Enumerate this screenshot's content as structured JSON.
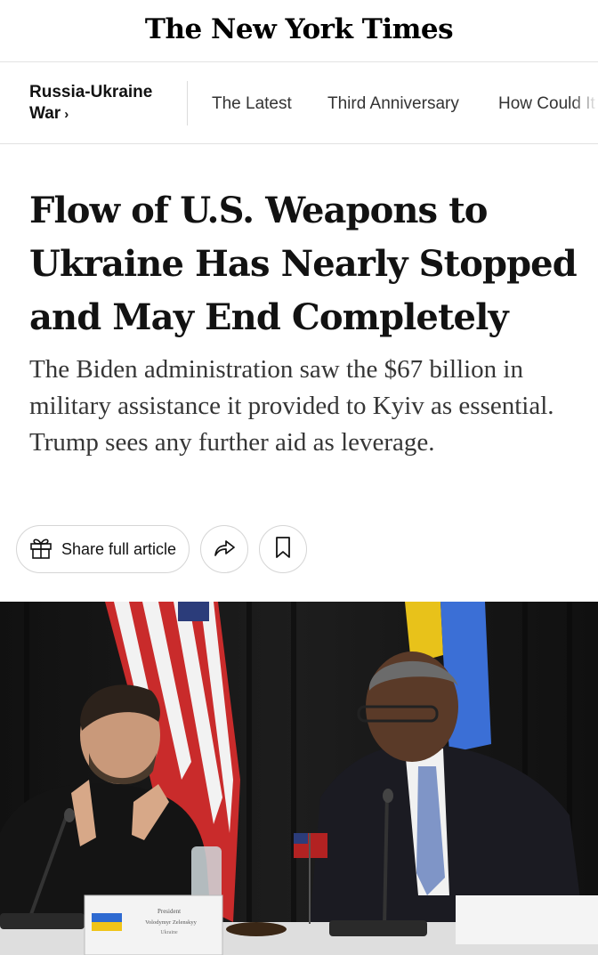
{
  "masthead": {
    "logo_text": "The New York Times"
  },
  "subnav": {
    "section": "Russia-Ukraine War",
    "chevron": "›",
    "items": [
      "The Latest",
      "Third Anniversary",
      "How Could It"
    ]
  },
  "article": {
    "headline": "Flow of U.S. Weapons to Ukraine Has Nearly Stopped and May End Completely",
    "summary": "The Biden administration saw the $67 billion in military assistance it provided to Kyiv as essential. Trump sees any further aid as leverage."
  },
  "actions": {
    "share_label": "Share full article",
    "icons": [
      "gift-icon",
      "share-arrow-icon",
      "bookmark-icon"
    ]
  },
  "photo": {
    "placard_line1": "President",
    "placard_line2": "Volodymyr Zelenskyy",
    "placard_line3": "Ukraine"
  }
}
